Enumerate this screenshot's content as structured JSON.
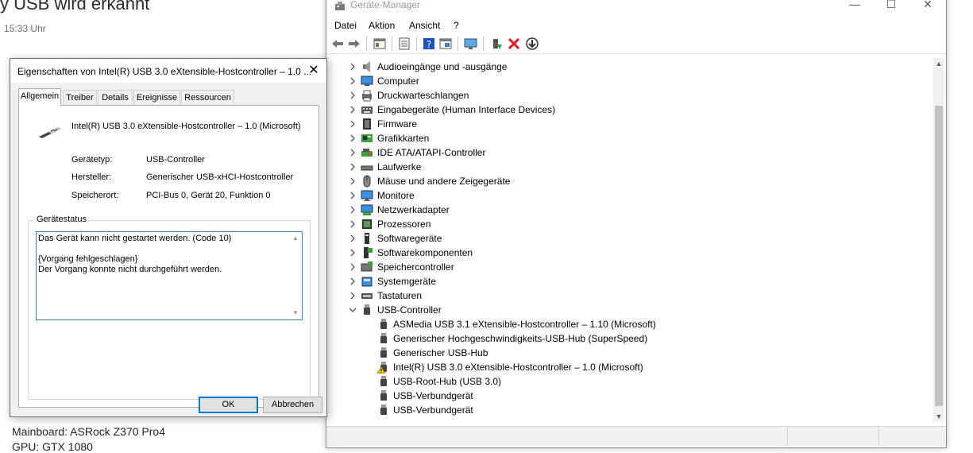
{
  "background_page": {
    "title": "y USB wird erkannt",
    "time": "15:33 Uhr",
    "lines": [
      "Mainboard: ASRock Z370 Pro4",
      "GPU: GTX 1080"
    ]
  },
  "device_manager": {
    "title": "Geräte-Manager",
    "window_controls": {
      "minimize": "—",
      "maximize": "☐",
      "close": "✕"
    },
    "menu": [
      "Datei",
      "Aktion",
      "Ansicht",
      "?"
    ],
    "tree": [
      {
        "label": "Audioeingänge und -ausgänge",
        "icon": "speaker-icon",
        "expanded": false
      },
      {
        "label": "Computer",
        "icon": "computer-icon",
        "expanded": false
      },
      {
        "label": "Druckwarteschlangen",
        "icon": "printer-icon",
        "expanded": false
      },
      {
        "label": "Eingabegeräte (Human Interface Devices)",
        "icon": "hid-icon",
        "expanded": false
      },
      {
        "label": "Firmware",
        "icon": "firmware-icon",
        "expanded": false
      },
      {
        "label": "Grafikkarten",
        "icon": "display-adapter-icon",
        "expanded": false
      },
      {
        "label": "IDE ATA/ATAPI-Controller",
        "icon": "ide-icon",
        "expanded": false
      },
      {
        "label": "Laufwerke",
        "icon": "disk-drive-icon",
        "expanded": false
      },
      {
        "label": "Mäuse und andere Zeigegeräte",
        "icon": "mouse-icon",
        "expanded": false
      },
      {
        "label": "Monitore",
        "icon": "monitor-icon",
        "expanded": false
      },
      {
        "label": "Netzwerkadapter",
        "icon": "network-adapter-icon",
        "expanded": false
      },
      {
        "label": "Prozessoren",
        "icon": "processor-icon",
        "expanded": false
      },
      {
        "label": "Softwaregeräte",
        "icon": "software-device-icon",
        "expanded": false
      },
      {
        "label": "Softwarekomponenten",
        "icon": "software-component-icon",
        "expanded": false
      },
      {
        "label": "Speichercontroller",
        "icon": "storage-controller-icon",
        "expanded": false
      },
      {
        "label": "Systemgeräte",
        "icon": "system-device-icon",
        "expanded": false
      },
      {
        "label": "Tastaturen",
        "icon": "keyboard-icon",
        "expanded": false
      },
      {
        "label": "USB-Controller",
        "icon": "usb-icon",
        "expanded": true
      }
    ],
    "usb_children": [
      {
        "label": "ASMedia USB 3.1 eXtensible-Hostcontroller – 1.10 (Microsoft)",
        "warning": false
      },
      {
        "label": "Generischer Hochgeschwindigkeits-USB-Hub (SuperSpeed)",
        "warning": false
      },
      {
        "label": "Generischer USB-Hub",
        "warning": false
      },
      {
        "label": "Intel(R) USB 3.0 eXtensible-Hostcontroller – 1.0 (Microsoft)",
        "warning": true
      },
      {
        "label": "USB-Root-Hub (USB 3.0)",
        "warning": false
      },
      {
        "label": "USB-Verbundgerät",
        "warning": false
      },
      {
        "label": "USB-Verbundgerät",
        "warning": false
      }
    ]
  },
  "dialog": {
    "title": "Eigenschaften von Intel(R) USB 3.0 eXtensible-Hostcontroller – 1.0 ...",
    "close": "✕",
    "tabs": [
      "Allgemein",
      "Treiber",
      "Details",
      "Ereignisse",
      "Ressourcen"
    ],
    "active_tab": "Allgemein",
    "device_name": "Intel(R) USB 3.0 eXtensible-Hostcontroller – 1.0 (Microsoft)",
    "properties": [
      {
        "label": "Gerätetyp:",
        "value": "USB-Controller"
      },
      {
        "label": "Hersteller:",
        "value": "Generischer USB-xHCI-Hostcontroller"
      },
      {
        "label": "Speicherort:",
        "value": "PCI-Bus 0, Gerät 20, Funktion 0"
      }
    ],
    "status_group_label": "Gerätestatus",
    "status_lines": [
      "Das Gerät kann nicht gestartet werden. (Code 10)",
      "",
      "{Vorgang fehlgeschlagen}",
      "Der Vorgang konnte nicht durchgeführt werden."
    ],
    "buttons": {
      "ok": "OK",
      "cancel": "Abbrechen"
    }
  },
  "colors": {
    "accent": "#0078d7",
    "warning": "#f2c01e",
    "delete": "#e81123"
  }
}
